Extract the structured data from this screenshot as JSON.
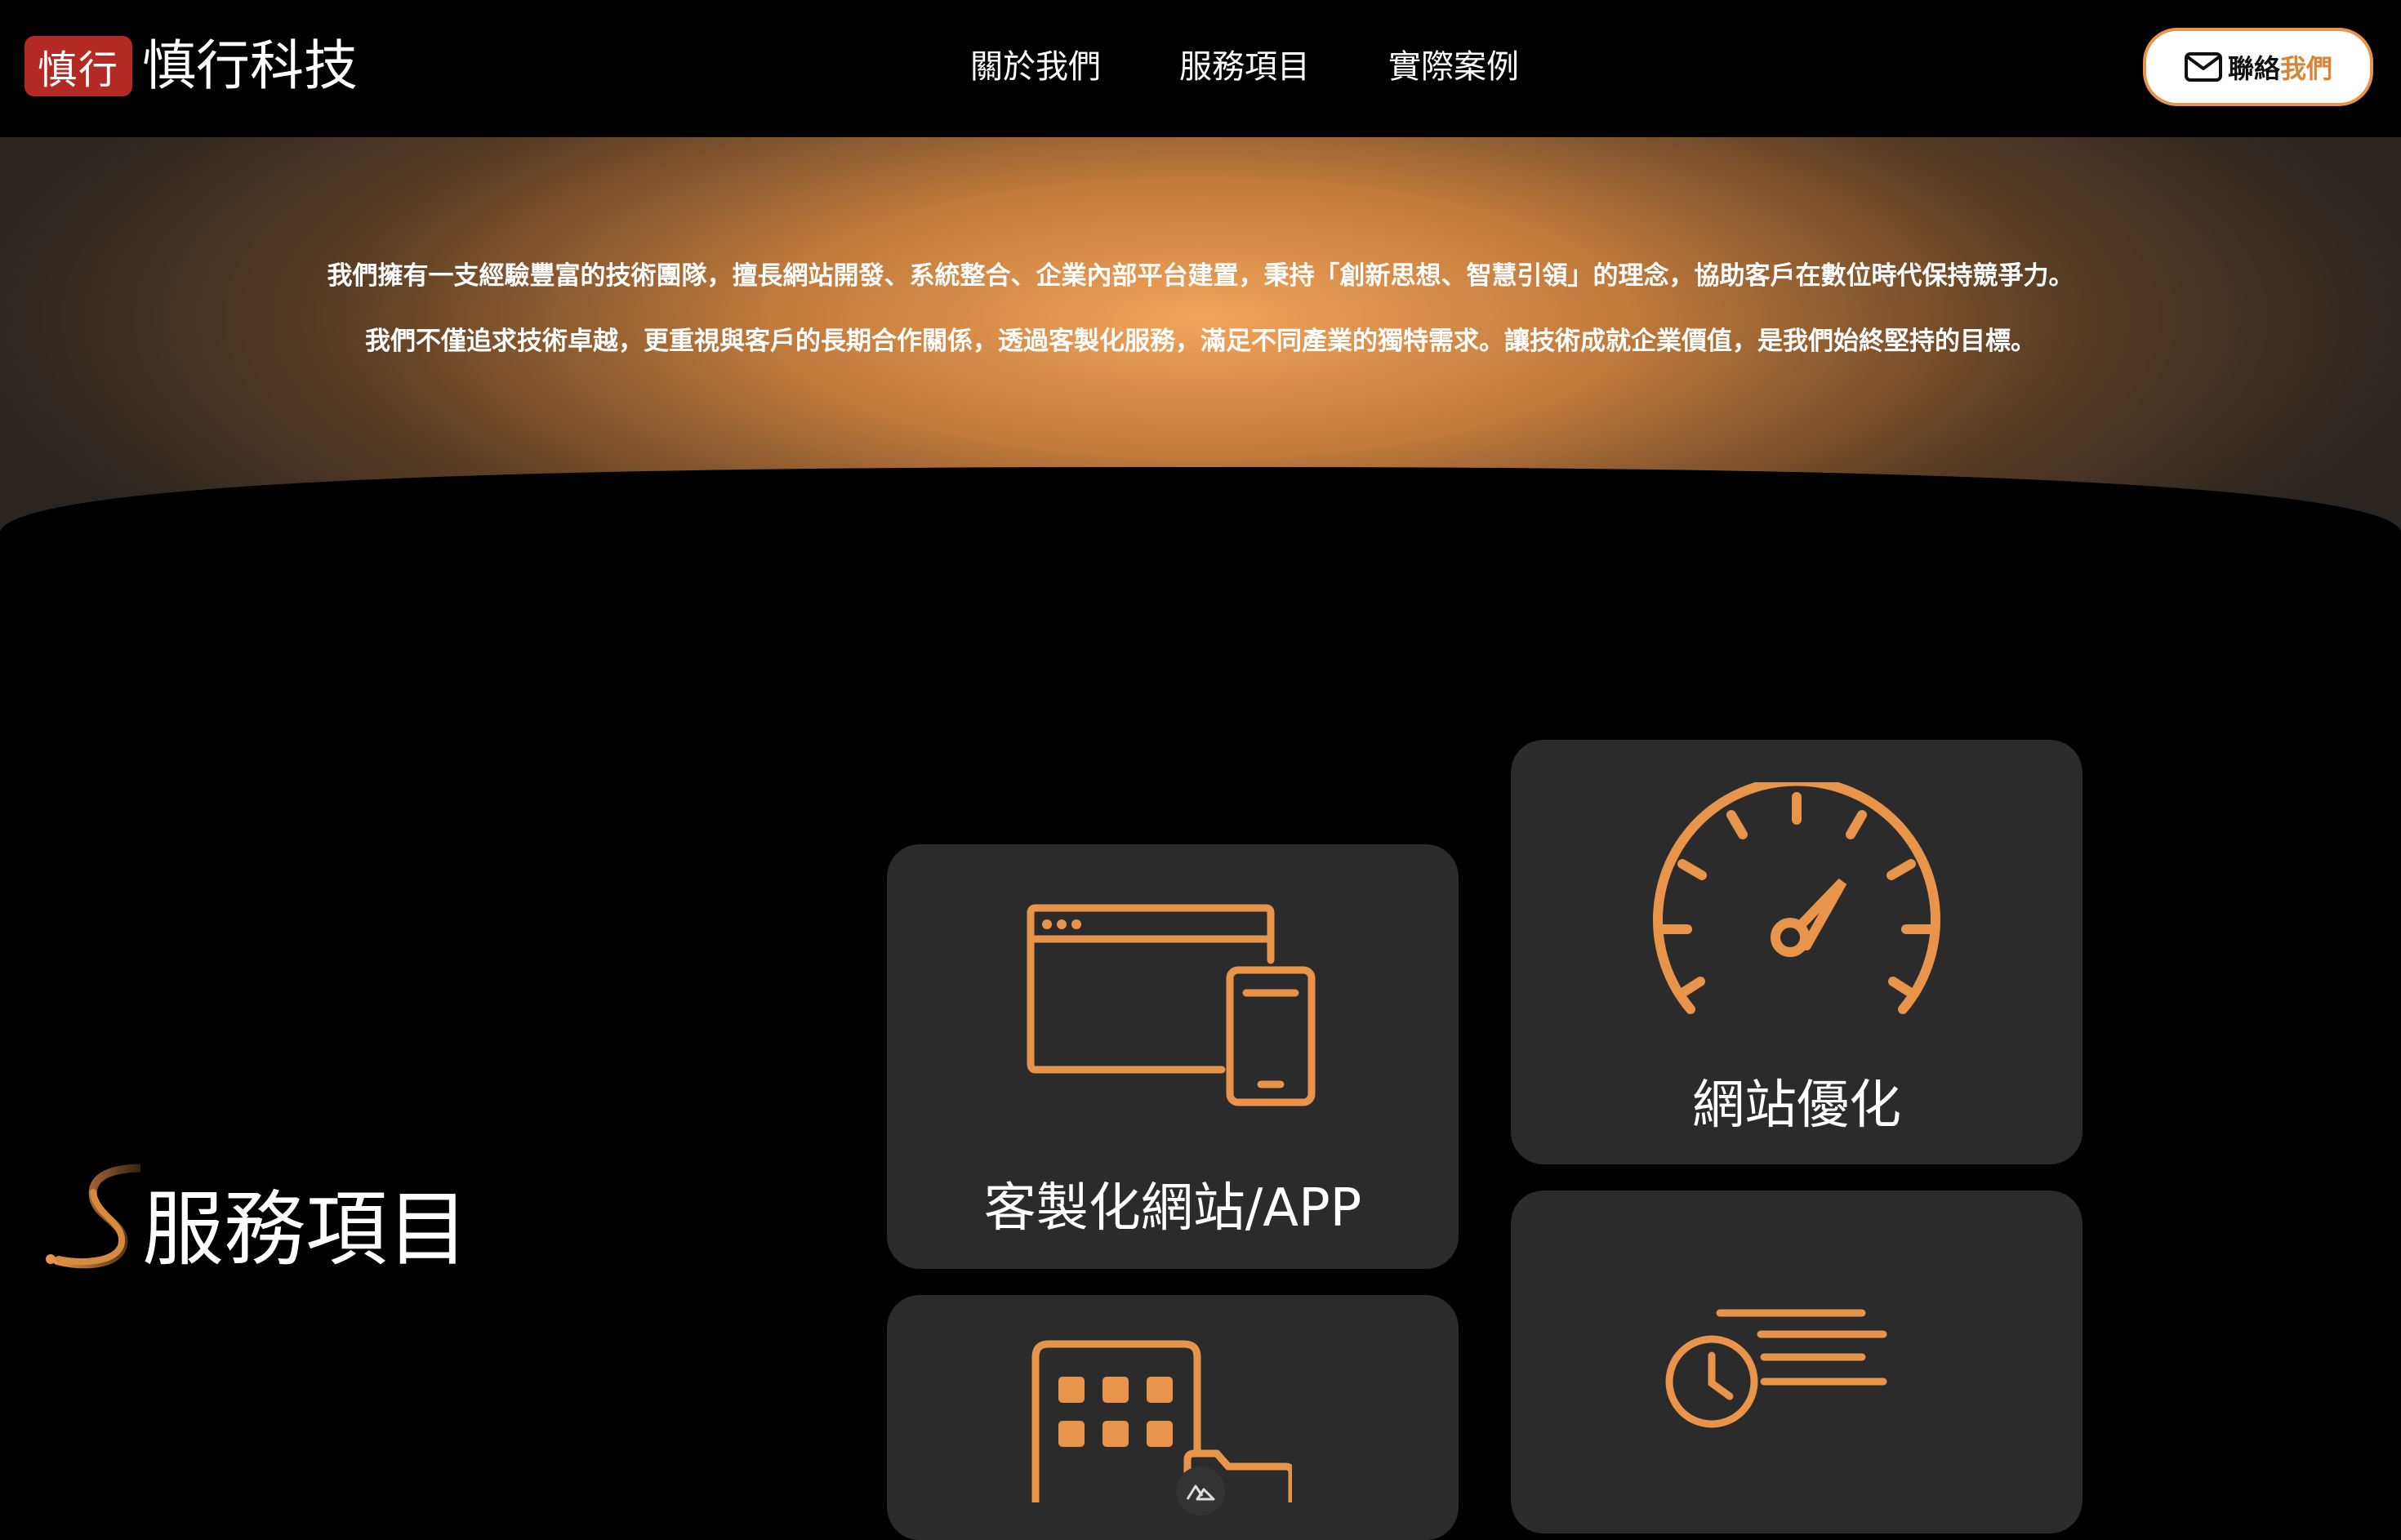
{
  "header": {
    "logo_seal": "慎行",
    "brand_name": "慎行科技",
    "nav": [
      {
        "label": "關於我們"
      },
      {
        "label": "服務項目"
      },
      {
        "label": "實際案例"
      }
    ],
    "contact": {
      "label_main": "聯絡",
      "label_accent": "我們",
      "icon": "mail-icon"
    }
  },
  "hero": {
    "paragraphs": [
      "我們擁有一支經驗豐富的技術團隊，擅長網站開發、系統整合、企業內部平台建置，秉持「創新思想、智慧引領」的理念，協助客戶在數位時代保持競爭力。",
      "我們不僅追求技術卓越，更重視與客戶的長期合作關係，透過客製化服務，滿足不同產業的獨特需求。讓技術成就企業價值，是我們始終堅持的目標。"
    ]
  },
  "services": {
    "title": "服務項目",
    "cards": [
      {
        "label": "網站優化",
        "icon": "speedometer-icon"
      },
      {
        "label": "客製化網站/APP",
        "icon": "browser-mobile-icon"
      },
      {
        "label": "",
        "icon": "fast-clock-icon"
      },
      {
        "label": "",
        "icon": "app-grid-folder-icon"
      }
    ]
  },
  "colors": {
    "accent": "#e8944a",
    "card_bg": "#2b2b2b",
    "background": "#000000",
    "seal": "#b32a24"
  }
}
